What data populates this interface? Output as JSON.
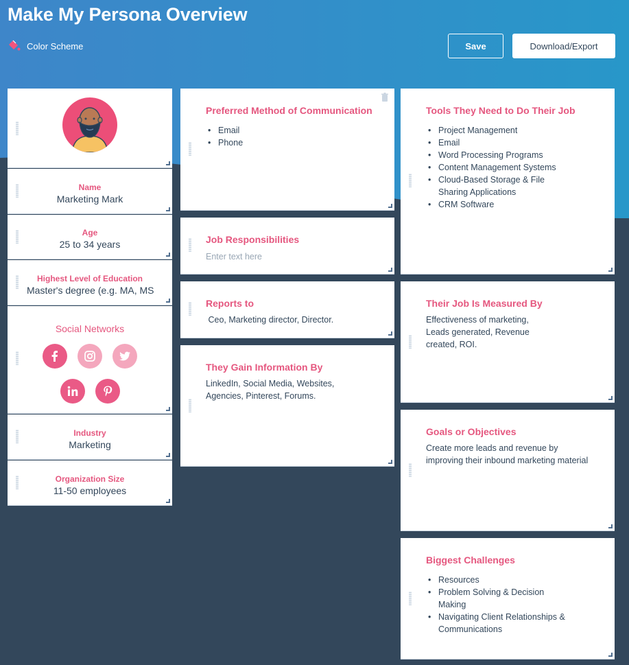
{
  "header": {
    "title": "Make My Persona Overview",
    "color_scheme_label": "Color Scheme",
    "save_label": "Save",
    "export_label": "Download/Export"
  },
  "colors": {
    "accent": "#e5577f",
    "header_blue": "#2e8ec8",
    "dark_navy": "#33475b",
    "text": "#33475b"
  },
  "persona": {
    "avatar_icon": "bearded-man-avatar",
    "fields": [
      {
        "label": "Name",
        "value": "Marketing Mark"
      },
      {
        "label": "Age",
        "value": "25 to 34 years"
      },
      {
        "label": "Highest Level of Education",
        "value": "Master's degree (e.g. MA, MS"
      },
      {
        "label": "Industry",
        "value": "Marketing"
      },
      {
        "label": "Organization Size",
        "value": "11-50 employees"
      }
    ],
    "social": {
      "title": "Social Networks",
      "networks": [
        {
          "name": "facebook",
          "active": true
        },
        {
          "name": "instagram",
          "active": false
        },
        {
          "name": "twitter",
          "active": false
        },
        {
          "name": "linkedin",
          "active": true
        },
        {
          "name": "pinterest",
          "active": true
        }
      ]
    }
  },
  "cards": {
    "communication": {
      "title": "Preferred Method of Communication",
      "items": [
        "Email",
        "Phone"
      ]
    },
    "responsibilities": {
      "title": "Job Responsibilities",
      "placeholder": "Enter text here"
    },
    "reports_to": {
      "title": "Reports to",
      "text": " Ceo, Marketing director, Director."
    },
    "gain_info": {
      "title": "They Gain Information By",
      "text": "LinkedIn, Social Media, Websites, Agencies, Pinterest, Forums."
    },
    "tools": {
      "title": "Tools They Need to Do Their Job",
      "items": [
        "Project Management",
        "Email",
        "Word Processing Programs",
        "Content Management Systems",
        "Cloud-Based Storage & File Sharing Applications",
        "CRM Software"
      ]
    },
    "measured": {
      "title": "Their Job Is Measured By",
      "text": "Effectiveness of marketing, Leads generated, Revenue created, ROI."
    },
    "goals": {
      "title": "Goals or Objectives",
      "text": "Create more leads and revenue by improving their inbound marketing material"
    },
    "challenges": {
      "title": "Biggest Challenges",
      "items": [
        "Resources",
        "Problem Solving & Decision Making",
        "Navigating Client Relationships & Communications"
      ]
    }
  }
}
